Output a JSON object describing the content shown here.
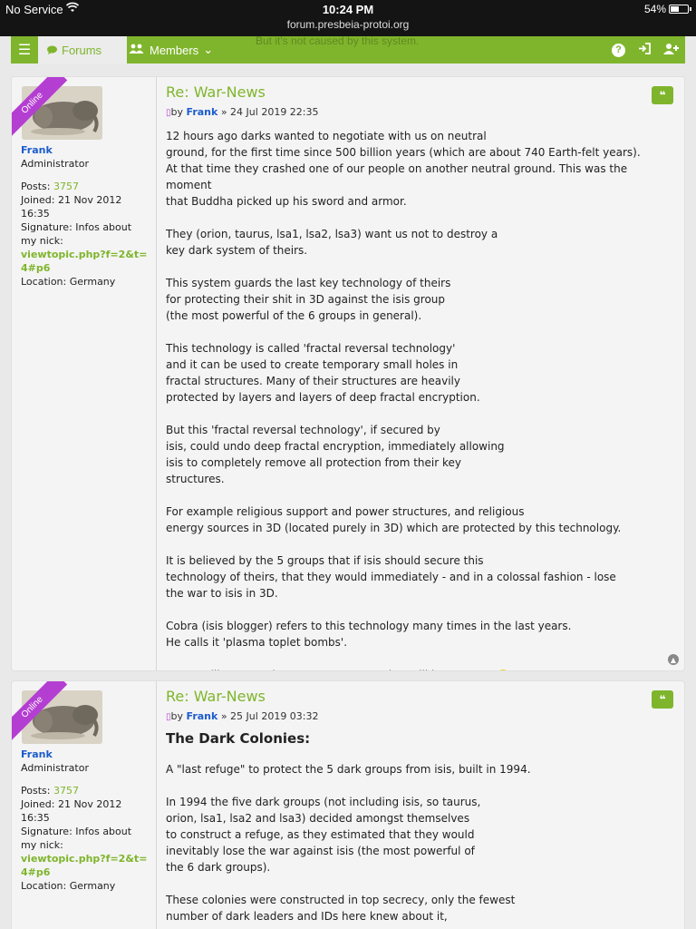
{
  "status_bar": {
    "carrier": "No Service",
    "time": "10:24 PM",
    "url": "forum.presbeia-protoi.org",
    "battery": "54%",
    "battery_level": 0.54
  },
  "nav": {
    "forums_label": "Forums",
    "members_label": "Members",
    "ghost_text": "But it's not caused by this system."
  },
  "posts": [
    {
      "online_label": "Online",
      "username": "Frank",
      "rank": "Administrator",
      "posts_label": "Posts:",
      "posts_count": "3757",
      "joined": "Joined: 21 Nov 2012 16:35",
      "signature": "Signature: Infos about my nick:",
      "signature_link": "viewtopic.php?f=2&t=4#p6",
      "location": "Location: Germany",
      "title": "Re: War-News",
      "by": "by",
      "author": "Frank",
      "date": "» 24 Jul 2019 22:35",
      "paragraphs": [
        "12 hours ago darks wanted to negotiate with us on neutral\nground, for the first time since 500 billion years (which are about 740 Earth-felt years).\nAt that time they crashed one of our people on another neutral ground. This was the moment\nthat Buddha picked up his sword and armor.",
        "They (orion, taurus, lsa1, lsa2, lsa3) want us not to destroy a\nkey dark system of theirs.",
        "This system guards the last key technology of theirs\nfor protecting their shit in 3D against the isis group\n(the most powerful of the 6 groups in general).",
        "This technology is called 'fractal reversal technology'\nand it can be used to create temporary small holes in\nfractal structures. Many of their structures are heavily\nprotected by layers and layers of deep fractal encryption.",
        "But this 'fractal reversal technology', if secured by\nisis, could undo deep fractal encryption, immediately allowing\nisis to completely remove all protection from their key\nstructures.",
        "For example religious support and power structures, and religious\nenergy sources in 3D (located purely in 3D) which are protected by this technology.",
        "It is believed by the 5 groups that if isis should secure this\ntechnology of theirs, that they would immediately - and in a colossal fashion - lose\nthe war to isis in 3D.",
        "Cobra (isis blogger) refers to this technology many times in the last years.\nHe calls it 'plasma toplet bombs'.",
        "So we will remove them now. Let's see what will happen..."
      ]
    },
    {
      "online_label": "Online",
      "username": "Frank",
      "rank": "Administrator",
      "posts_label": "Posts:",
      "posts_count": "3757",
      "joined": "Joined: 21 Nov 2012 16:35",
      "signature": "Signature: Infos about my nick:",
      "signature_link": "viewtopic.php?f=2&t=4#p6",
      "location": "Location: Germany",
      "title": "Re: War-News",
      "by": "by",
      "author": "Frank",
      "date": "» 25 Jul 2019 03:32",
      "heading": "The Dark Colonies:",
      "paragraphs": [
        "A \"last refuge\" to protect the 5 dark groups from isis, built in 1994.",
        "In 1994 the five dark groups (not including isis, so taurus,\norion, lsa1, lsa2 and lsa3) decided amongst themselves\nto construct a refuge, as they estimated that they would\ninevitably lose the war against isis (the most powerful of\nthe 6 dark groups).",
        "These colonies were constructed in top secrecy, only the fewest\nnumber of dark leaders and IDs here knew about it,"
      ]
    }
  ],
  "colors": {
    "accent": "#7fb52c",
    "username": "#1d5ccc",
    "online_ribbon": "#b43ed2"
  }
}
